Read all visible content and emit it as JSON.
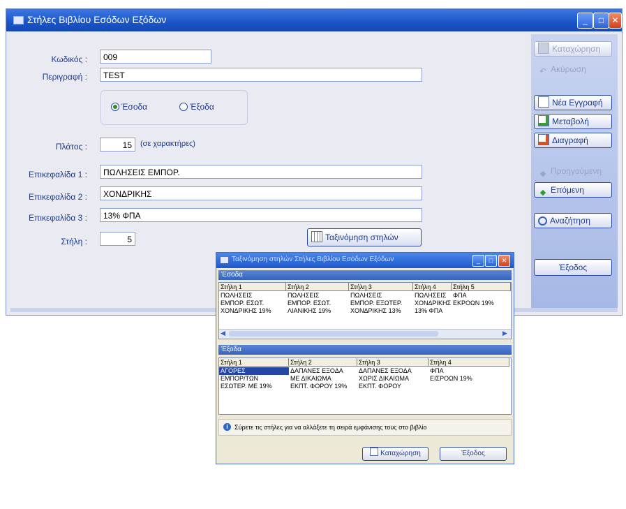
{
  "window": {
    "title": "Στήλες Βιβλίου Εσόδων Εξόδων",
    "controls": [
      "_",
      "□",
      "✕"
    ]
  },
  "form": {
    "code_label": "Κωδικός :",
    "code_value": "009",
    "desc_label": "Περιγραφή :",
    "desc_value": "TEST",
    "radio_income": "Έσοδα",
    "radio_expense": "Έξοδα",
    "width_label": "Πλάτος :",
    "width_value": "15",
    "width_unit": "(σε χαρακτήρες)",
    "header1_label": "Επικεφαλίδα 1 :",
    "header1_value": "ΠΩΛΗΣΕΙΣ ΕΜΠΟΡ.",
    "header2_label": "Επικεφαλίδα 2 :",
    "header2_value": "ΧΟΝΔΡΙΚΗΣ",
    "header3_label": "Επικεφαλίδα 3 :",
    "header3_value": "13% ΦΠΑ",
    "column_label": "Στήλη :",
    "column_value": "5",
    "order_button": "Ταξινόμηση στηλών"
  },
  "sidebar": {
    "save": "Καταχώρηση",
    "cancel": "Ακύρωση",
    "new": "Νέα Εγγραφή",
    "edit": "Μεταβολή",
    "delete": "Διαγραφή",
    "previous": "Προηγούμενη",
    "next": "Επόμενη",
    "search": "Αναζήτηση",
    "exit": "Έξοδος"
  },
  "dialog": {
    "title": "Ταξινόμηση στηλών Στήλες Βιβλίου Εσόδων Εξόδων",
    "income_group": "Έσοδα",
    "income_headers": [
      "Στήλη 1",
      "Στήλη 2",
      "Στήλη 3",
      "Στήλη 4",
      "Στήλη 5"
    ],
    "income_rows": [
      [
        "ΠΩΛΗΣΕΙΣ",
        "ΠΩΛΗΣΕΙΣ",
        "ΠΩΛΗΣΕΙΣ",
        "ΠΩΛΗΣΕΙΣ",
        "ΦΠΑ"
      ],
      [
        "ΕΜΠΟΡ. ΕΣΩΤ.",
        "ΕΜΠΟΡ. ΕΣΩΤ.",
        "ΕΜΠΟΡ. ΕΞΩΤΕΡ.",
        "ΧΟΝΔΡΙΚΗΣ",
        "ΕΚΡΟΩΝ 19%"
      ],
      [
        "ΧΟΝΔΡΙΚΗΣ 19%",
        "ΛΙΑΝΙΚΗΣ 19%",
        "ΧΟΝΔΡΙΚΗΣ 13%",
        "13% ΦΠΑ",
        ""
      ]
    ],
    "expense_group": "Έξοδα",
    "expense_headers": [
      "Στήλη 1",
      "Στήλη 2",
      "Στήλη 3",
      "Στήλη 4"
    ],
    "expense_rows": [
      [
        "ΑΓΟΡΕΣ",
        "ΔΑΠΑΝΕΣ ΕΞΟΔΑ",
        "ΔΑΠΑΝΕΣ ΕΞΟΔΑ",
        "ΦΠΑ"
      ],
      [
        "ΕΜΠΟΡ/ΤΩΝ",
        "ΜΕ ΔΙΚΑΙΩΜΑ",
        "ΧΩΡΙΣ ΔΙΚΑΙΩΜΑ",
        "ΕΙΣΡΟΩΝ 19%"
      ],
      [
        "ΕΣΩΤΕΡ. ΜΕ 19%",
        "ΕΚΠΤ. ΦΟΡΟΥ 19%",
        "ΕΚΠΤ. ΦΟΡΟΥ",
        ""
      ]
    ],
    "info_text": "Σύρετε τις στήλες για να αλλάξετε τη σειρά εμφάνισης τους στο βιβλίο",
    "save": "Καταχώρηση",
    "exit": "Έξοδος"
  }
}
